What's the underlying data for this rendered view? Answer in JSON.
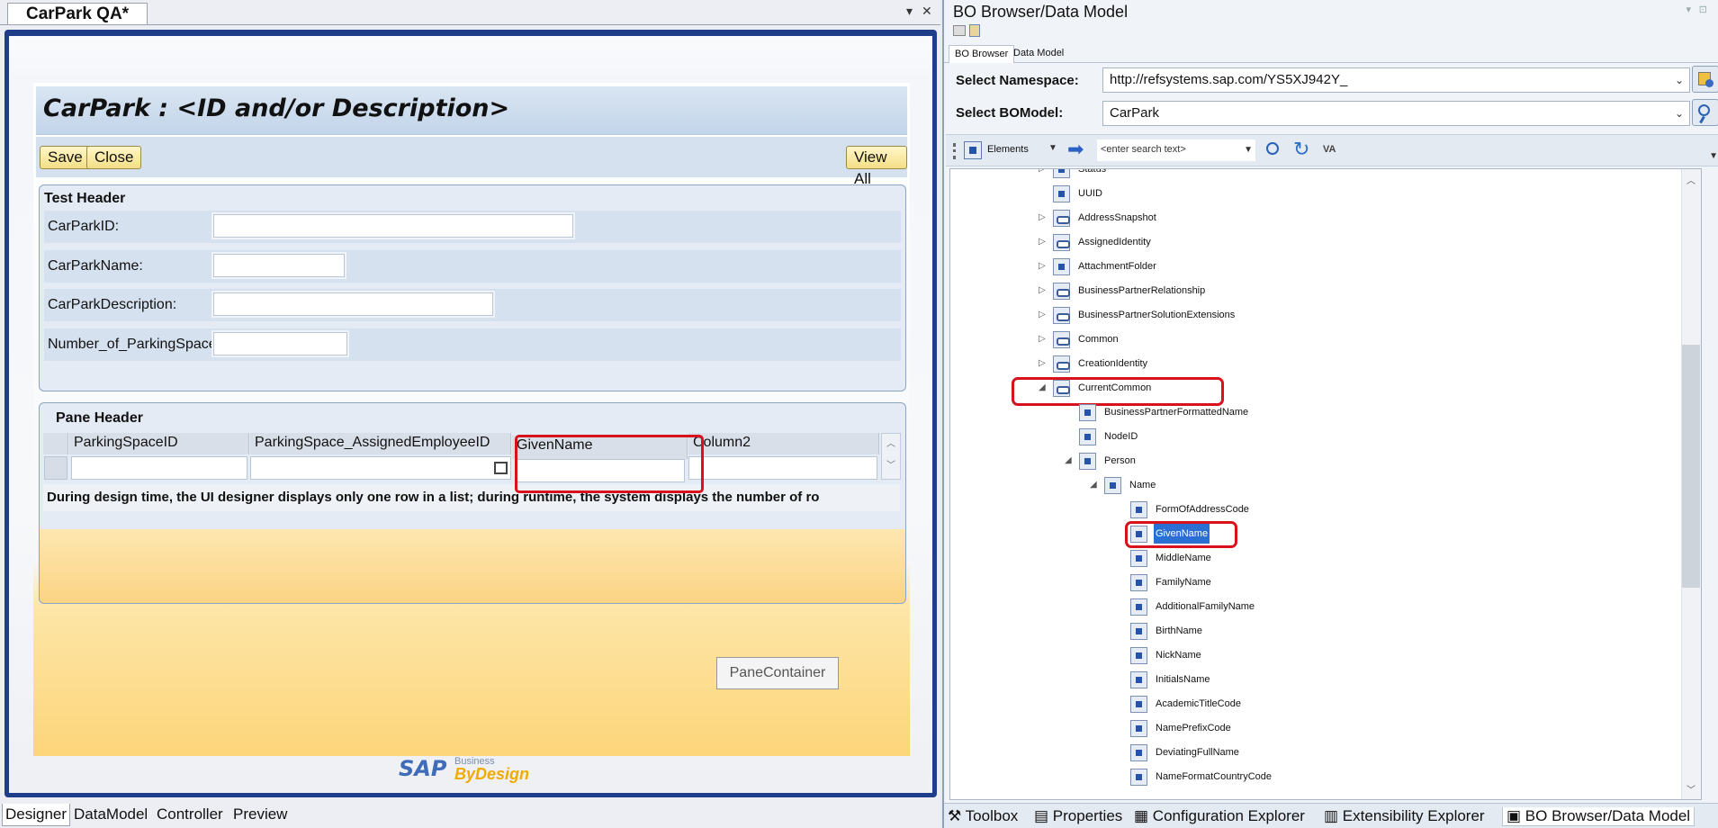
{
  "designer": {
    "doc_tab": "CarPark QA*",
    "page_title": "CarPark : <ID and/or Description>",
    "toolbar": {
      "save": "Save",
      "close": "Close",
      "view_all": "View All"
    },
    "header_section": {
      "title": "Test Header",
      "fields": [
        {
          "label": "CarParkID:"
        },
        {
          "label": "CarParkName:"
        },
        {
          "label": "CarParkDescription:"
        },
        {
          "label": "Number_of_ParkingSpaces:"
        }
      ]
    },
    "pane": {
      "title": "Pane Header",
      "columns": [
        "ParkingSpaceID",
        "ParkingSpace_AssignedEmployeeID",
        "GivenName",
        "Column2"
      ],
      "note": "During design time, the UI designer displays only one row in a list; during runtime, the system displays the number of ro"
    },
    "pane_container": "PaneContainer",
    "logo": {
      "brand": "SAP",
      "line1": "Business",
      "line2": "ByDesign"
    },
    "bottom_tabs": [
      "Designer",
      "DataModel",
      "Controller",
      "Preview"
    ]
  },
  "bo_browser": {
    "title": "BO Browser/Data Model",
    "tabs": [
      "BO Browser",
      "Data Model"
    ],
    "namespace_label": "Select Namespace:",
    "namespace_value": "http://refsystems.sap.com/YS5XJ942Y_",
    "bomodel_label": "Select BOModel:",
    "bomodel_value": "CarPark",
    "filter_value": "Elements",
    "search_placeholder": "<enter search text>",
    "va_label": "VA",
    "tree": {
      "status_partial": "Status",
      "uuid": "UUID",
      "address_snapshot": "AddressSnapshot",
      "assigned_identity": "AssignedIdentity",
      "attachment_folder": "AttachmentFolder",
      "bp_relationship": "BusinessPartnerRelationship",
      "bp_solution_ext": "BusinessPartnerSolutionExtensions",
      "common": "Common",
      "creation_identity": "CreationIdentity",
      "current_common": "CurrentCommon",
      "bp_formatted_name": "BusinessPartnerFormattedName",
      "node_id": "NodeID",
      "person": "Person",
      "name": "Name",
      "form_of_address_code": "FormOfAddressCode",
      "given_name": "GivenName",
      "middle_name": "MiddleName",
      "family_name": "FamilyName",
      "additional_family_name": "AdditionalFamilyName",
      "birth_name": "BirthName",
      "nick_name": "NickName",
      "initials_name": "InitialsName",
      "academic_title_code": "AcademicTitleCode",
      "name_prefix_code": "NamePrefixCode",
      "deviating_full_name": "DeviatingFullName",
      "name_format_country_code": "NameFormatCountryCode"
    },
    "bottom_tools": [
      "Toolbox",
      "Properties",
      "Configuration Explorer",
      "Extensibility Explorer",
      "BO Browser/Data Model"
    ]
  },
  "colors": {
    "highlight": "#d7121c",
    "selection": "#2b6fd4",
    "frame": "#1e3e8a",
    "sap_blue": "#1a54a6",
    "sap_orange": "#f0ab00"
  }
}
